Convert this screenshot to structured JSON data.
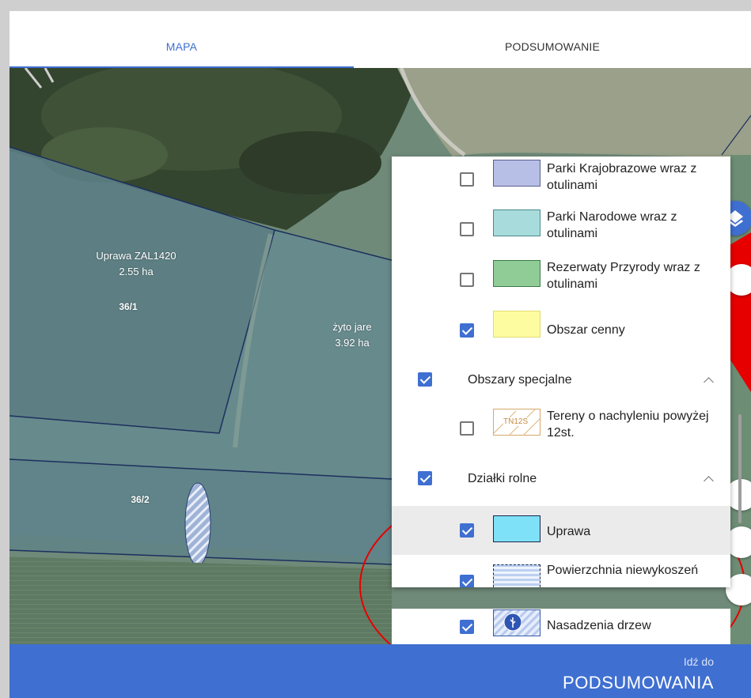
{
  "tabs": {
    "map": "MAPA",
    "summary": "PODSUMOWANIE"
  },
  "map": {
    "parcel_a_label": "Uprawa ZAL1420",
    "parcel_a_area": "2.55 ha",
    "parcel_a_id": "36/1",
    "parcel_b_label": "żyto jare",
    "parcel_b_area": "3.92 ha",
    "parcel_c_id": "36/2"
  },
  "legend": {
    "items_top": [
      {
        "label": "Parki Krajobrazowe wraz z otulinami",
        "checked": false,
        "swatch_color": "#b8bfe6"
      },
      {
        "label": "Parki Narodowe wraz z otulinami",
        "checked": false,
        "swatch_color": "#a8dcdc"
      },
      {
        "label": "Rezerwaty Przyrody wraz z otulinami",
        "checked": false,
        "swatch_color": "#8fcc96"
      },
      {
        "label": "Obszar cenny",
        "checked": true,
        "swatch_color": "#fdfca0"
      }
    ],
    "group_special": {
      "label": "Obszary specjalne",
      "checked": true
    },
    "item_slope": {
      "label": "Tereny o nachyleniu powyżej 12st.",
      "swatch_text": "TN12S",
      "checked": false
    },
    "group_parcels": {
      "label": "Działki rolne",
      "checked": true
    },
    "items_parcels": [
      {
        "label": "Uprawa",
        "checked": true,
        "swatch_color": "#7fe1f7"
      },
      {
        "label": "Powierzchnia niewykoszeń",
        "checked": true
      },
      {
        "label": "Nasadzenia drzew",
        "checked": true
      }
    ]
  },
  "bottom": {
    "small": "Idź do",
    "big": "PODSUMOWANIA"
  },
  "colors": {
    "accent": "#3f6fd1",
    "annotation": "#e60000"
  }
}
